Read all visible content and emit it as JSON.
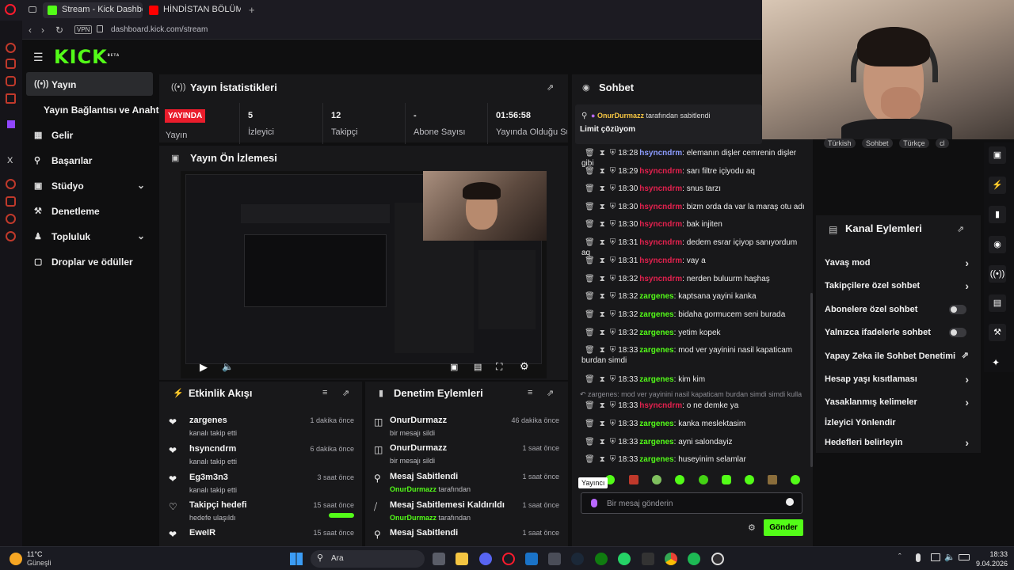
{
  "browser": {
    "tabs": [
      {
        "label": "Stream - Kick Dashboard",
        "active": true
      },
      {
        "label": "HİNDİSTAN BÖLÜM 2: VAR",
        "active": false
      }
    ],
    "vpn": "VPN",
    "url": "dashboard.kick.com/stream"
  },
  "app": {
    "logo": "KICK",
    "logo_sup": "BETA",
    "nav": [
      {
        "label": "Yayın",
        "icon": "broadcast-icon",
        "active": true,
        "chevron": false
      },
      {
        "label": "Yayın Bağlantısı ve Anahtarı",
        "icon": "",
        "active": false,
        "chevron": false
      },
      {
        "label": "Gelir",
        "icon": "chart-icon",
        "active": false,
        "chevron": false
      },
      {
        "label": "Başarılar",
        "icon": "trophy-icon",
        "active": false,
        "chevron": false
      },
      {
        "label": "Stüdyo",
        "icon": "studio-icon",
        "active": false,
        "chevron": true
      },
      {
        "label": "Denetleme",
        "icon": "hammer-icon",
        "active": false,
        "chevron": false
      },
      {
        "label": "Topluluk",
        "icon": "people-icon",
        "active": false,
        "chevron": true
      },
      {
        "label": "Droplar ve ödüller",
        "icon": "gift-icon",
        "active": false,
        "chevron": false
      }
    ]
  },
  "stats": {
    "title": "Yayın İstatistikleri",
    "badge": "YAYINDA",
    "badge_label": "Yayın",
    "items": [
      {
        "value": "5",
        "label": "İzleyici"
      },
      {
        "value": "12",
        "label": "Takipçi"
      },
      {
        "value": "-",
        "label": "Abone Sayısı"
      },
      {
        "value": "01:56:58",
        "label": "Yayında Olduğu Süre"
      }
    ]
  },
  "preview": {
    "title": "Yayın Ön İzlemesi"
  },
  "activity": {
    "title": "Etkinlik Akışı",
    "items": [
      {
        "name": "zargenes",
        "sub": "kanalı takip etti",
        "time": "1 dakika önce",
        "icon": "heart-icon"
      },
      {
        "name": "hsyncndrm",
        "sub": "kanalı takip etti",
        "time": "6 dakika önce",
        "icon": "heart-icon"
      },
      {
        "name": "Eg3m3n3",
        "sub": "kanalı takip etti",
        "time": "3 saat önce",
        "icon": "heart-icon"
      },
      {
        "name": "Takipçi hedefi",
        "sub": "hedefe ulaşıldı",
        "time": "15 saat önce",
        "icon": "heart-outline-icon",
        "progress": 1.0
      },
      {
        "name": "EweIR",
        "sub": "",
        "time": "15 saat önce",
        "icon": "heart-icon"
      }
    ]
  },
  "moderation": {
    "title": "Denetim Eylemleri",
    "items": [
      {
        "name": "OnurDurmazz",
        "sub": "bir mesajı sildi",
        "time": "46 dakika önce",
        "icon": "trash-icon"
      },
      {
        "name": "OnurDurmazz",
        "sub": "bir mesajı sildi",
        "time": "1 saat önce",
        "icon": "trash-icon"
      },
      {
        "name": "Mesaj Sabitlendi",
        "sub_user": "OnurDurmazz",
        "sub": "tarafından",
        "time": "1 saat önce",
        "icon": "pin-icon"
      },
      {
        "name": "Mesaj Sabitlemesi Kaldırıldı",
        "sub_user": "OnurDurmazz",
        "sub": "tarafından",
        "time": "1 saat önce",
        "icon": "unpin-icon"
      },
      {
        "name": "Mesaj Sabitlendi",
        "sub_user": "",
        "sub": "",
        "time": "1 saat önce",
        "icon": "pin-icon"
      }
    ]
  },
  "chat": {
    "title": "Sohbet",
    "pinned_by": "OnurDurmazz",
    "pinned_by_suffix": "tarafından sabitlendi",
    "pinned_text": "Limit çözüyom",
    "messages": [
      {
        "time": "18:28",
        "user": "hsyncndrm",
        "color": "blue",
        "text": "elemanın dişler cemrenin dişler gibi"
      },
      {
        "time": "18:29",
        "user": "hsyncndrm",
        "color": "red",
        "text": "sarı filtre içiyodu aq"
      },
      {
        "time": "18:30",
        "user": "hsyncndrm",
        "color": "red",
        "text": "snus tarzı"
      },
      {
        "time": "18:30",
        "user": "hsyncndrm",
        "color": "red",
        "text": "bizm orda da var la maraş otu adı"
      },
      {
        "time": "18:30",
        "user": "hsyncndrm",
        "color": "red",
        "text": "bak injiten"
      },
      {
        "time": "18:31",
        "user": "hsyncndrm",
        "color": "red",
        "text": "dedem esrar içiyop sanıyordum aq"
      },
      {
        "time": "18:31",
        "user": "hsyncndrm",
        "color": "red",
        "text": "vay a"
      },
      {
        "time": "18:32",
        "user": "hsyncndrm",
        "color": "red",
        "text": "nerden buluurm haşhaş"
      },
      {
        "time": "18:32",
        "user": "zargenes",
        "color": "green",
        "text": "kaptsana yayini kanka"
      },
      {
        "time": "18:32",
        "user": "zargenes",
        "color": "green",
        "text": "bidaha gormucem seni burada"
      },
      {
        "time": "18:32",
        "user": "zargenes",
        "color": "green",
        "text": "yetim kopek"
      },
      {
        "time": "18:33",
        "user": "zargenes",
        "color": "green",
        "text": "mod ver yayinini nasil kapaticam burdan simdi"
      },
      {
        "time": "18:33",
        "user": "zargenes",
        "color": "green",
        "text": "kim kim"
      },
      {
        "time": "18:33",
        "user": "hsyncndrm",
        "color": "red",
        "text": "o ne demke ya"
      },
      {
        "time": "18:33",
        "user": "zargenes",
        "color": "green",
        "text": "kanka meslektasim"
      },
      {
        "time": "18:33",
        "user": "zargenes",
        "color": "green",
        "text": "ayni salondayiz"
      },
      {
        "time": "18:33",
        "user": "zargenes",
        "color": "green",
        "text": "huseyinim selamlar"
      }
    ],
    "reply_preview": "zargenes: mod ver yayinini nasil kapaticam burdan simdi simdi kulla...",
    "tooltip": "Yayıncı",
    "placeholder": "Bir mesaj gönderin",
    "send": "Gönder"
  },
  "webcam_tags": [
    "Türkish",
    "Sohbet",
    "Türkçe",
    "cl"
  ],
  "channel_actions": {
    "title": "Kanal Eylemleri",
    "items": [
      {
        "label": "Yavaş mod",
        "control": "arrow"
      },
      {
        "label": "Takipçilere özel sohbet",
        "control": "arrow"
      },
      {
        "label": "Abonelere özel sohbet",
        "control": "toggle"
      },
      {
        "label": "Yalnızca ifadelerle sohbet",
        "control": "toggle"
      },
      {
        "label": "Yapay Zeka ile Sohbet Denetimi",
        "control": "external"
      },
      {
        "label": "Hesap yaşı kısıtlaması",
        "control": "arrow"
      },
      {
        "label": "Yasaklanmış kelimeler",
        "control": "arrow"
      },
      {
        "label": "İzleyici Yönlendir",
        "control": "none"
      },
      {
        "label": "Hedefleri belirleyin",
        "control": "arrow"
      }
    ]
  },
  "taskbar": {
    "weather_temp": "11°C",
    "weather_text": "Güneşli",
    "search": "Ara",
    "time": "18:33",
    "date": "9.04.2026"
  }
}
